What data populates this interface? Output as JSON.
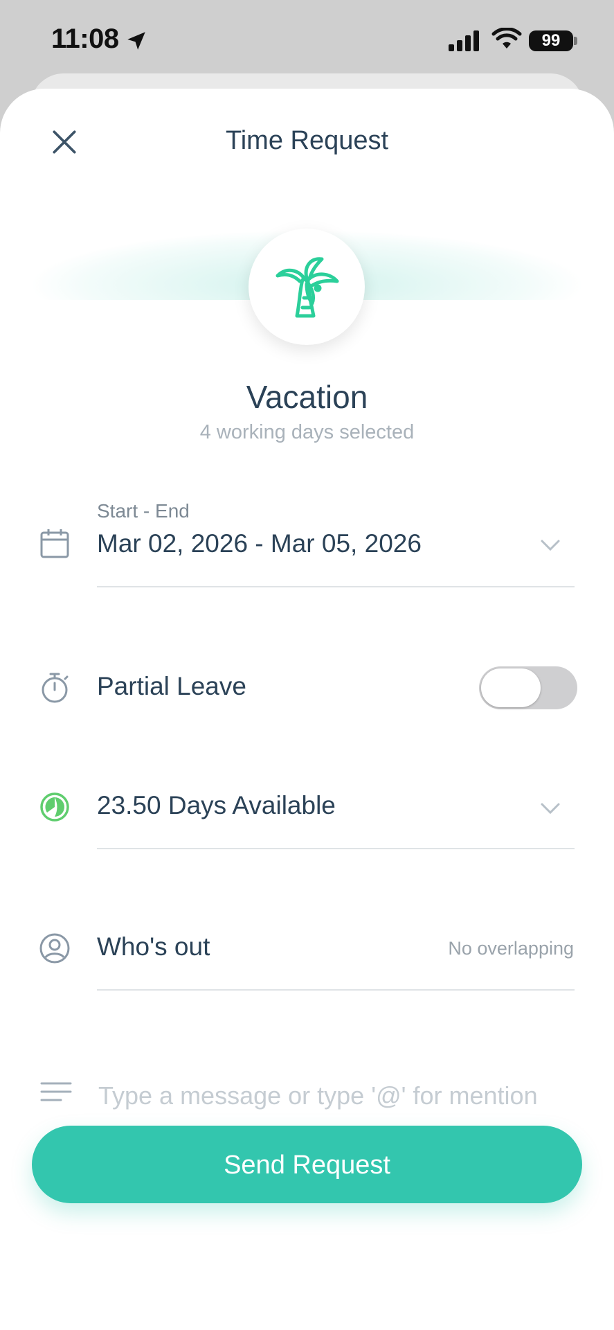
{
  "status_bar": {
    "time": "11:08",
    "battery": "99"
  },
  "header": {
    "title": "Time Request"
  },
  "leave_type": {
    "name": "Vacation",
    "summary": "4 working days selected",
    "icon": "palm-tree-icon",
    "accent": "#2bcf9a"
  },
  "date_range": {
    "label": "Start - End",
    "value": "Mar 02, 2026 - Mar 05, 2026"
  },
  "partial_leave": {
    "label": "Partial Leave",
    "enabled": false
  },
  "balance": {
    "value": "23.50  Days Available"
  },
  "whos_out": {
    "label": "Who's out",
    "status": "No overlapping"
  },
  "message": {
    "placeholder": "Type a message or type '@' for mention"
  },
  "actions": {
    "send_label": "Send Request",
    "send_color": "#33c6ae"
  }
}
